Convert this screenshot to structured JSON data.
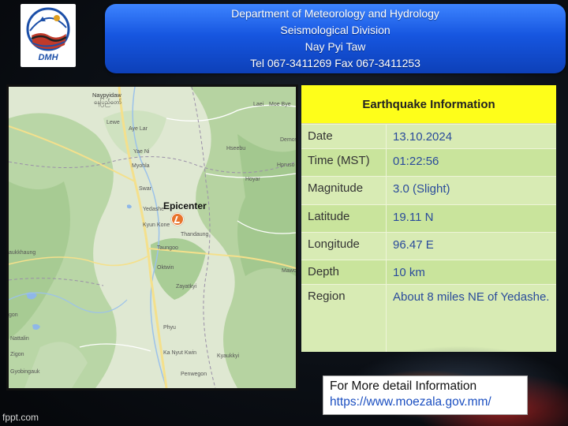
{
  "logo": {
    "text": "DMH"
  },
  "header": {
    "line1": "Department of Meteorology and Hydrology",
    "line2": "Seismological Division",
    "line3": "Nay Pyi Taw",
    "line4": "Tel 067-3411269 Fax 067-3411253"
  },
  "map": {
    "epicenter_label": "Epicenter",
    "places": {
      "naypyidaw": "Naypyidaw",
      "naypyidaw_mm": "နေပြည်တော်",
      "lewe": "Lewe",
      "ayelar": "Aye Lar",
      "yaeni": "Yae Ni",
      "myohla": "Myohla",
      "swar": "Swar",
      "yedashe": "Yedashe",
      "kyunkone": "Kyun Kone",
      "thandaung": "Thandaung",
      "taungoo": "Taungoo",
      "oktwin": "Oktwin",
      "zayatkyi": "Zayatkyi",
      "phyu": "Phyu",
      "kanyutkwin": "Ka Nyut Kwin",
      "kyaukkyi": "Kyaukkyi",
      "penwegon": "Penwegon",
      "nattalin": "Nattalin",
      "zigon": "Zigon",
      "gyobingauk": "Gyobingauk",
      "paukkhaung": "aukkhaung",
      "laei": "Laei",
      "moebye": "Moe Bye",
      "demoso": "Demos",
      "hseebu": "Hseebu",
      "hpruso": "Hpruso",
      "hoyar": "Hoyar",
      "mawchi": "Mawc",
      "gon": "gon"
    }
  },
  "info": {
    "title": "Earthquake Information",
    "rows": [
      {
        "label": "Date",
        "value": "13.10.2024"
      },
      {
        "label": "Time (MST)",
        "value": "01:22:56"
      },
      {
        "label": "Magnitude",
        "value": "3.0 (Slight)"
      },
      {
        "label": "Latitude",
        "value": "19.11 N"
      },
      {
        "label": "Longitude",
        "value": "96.47 E"
      },
      {
        "label": "Depth",
        "value": "10 km"
      },
      {
        "label": "Region",
        "value": "About 8 miles NE of Yedashe."
      }
    ]
  },
  "detail": {
    "line1": "For More detail Information",
    "line2": "https://www.moezala.gov.mm/"
  },
  "footer": {
    "text": "fppt.com"
  },
  "colors": {
    "header_blue": "#1656e0",
    "title_yellow": "#fefe1a",
    "table_green": "#bfdd8a",
    "value_blue": "#2a4b9b",
    "marker_orange": "#e8742c"
  }
}
